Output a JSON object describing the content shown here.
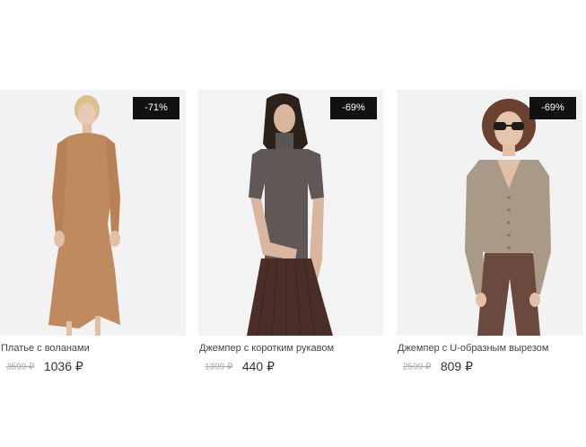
{
  "products": [
    {
      "discount": "-71%",
      "name": "Платье с воланами",
      "old_price": "3599 ₽",
      "new_price": "1036 ₽",
      "image_icon": "model-in-camel-knit-dress-image"
    },
    {
      "discount": "-69%",
      "name": "Джемпер с коротким рукавом",
      "old_price": "1399 ₽",
      "new_price": "440 ₽",
      "image_icon": "model-in-grey-short-sleeve-turtleneck-image"
    },
    {
      "discount": "-69%",
      "name": "Джемпер с U-образным вырезом",
      "old_price": "2599 ₽",
      "new_price": "809 ₽",
      "image_icon": "model-in-taupe-cardigan-image"
    }
  ],
  "colors": {
    "badge_bg": "#111111",
    "badge_text": "#ffffff",
    "old_price": "#a8a8a8",
    "photo_bg": "#f1f1f1"
  }
}
